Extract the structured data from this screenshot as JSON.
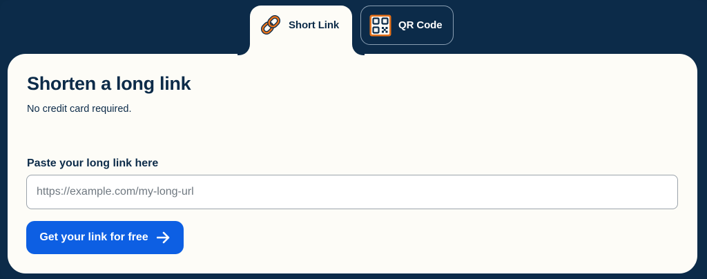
{
  "tabs": {
    "short_link": {
      "label": "Short Link",
      "icon": "link-icon",
      "active": true
    },
    "qr_code": {
      "label": "QR Code",
      "icon": "qr-code-icon",
      "active": false
    }
  },
  "card": {
    "title": "Shorten a long link",
    "subtitle": "No credit card required.",
    "field_label": "Paste your long link here",
    "input": {
      "value": "",
      "placeholder": "https://example.com/my-long-url"
    },
    "cta": {
      "label": "Get your link for free",
      "icon": "arrow-right-icon"
    }
  },
  "colors": {
    "background": "#0c2b49",
    "card": "#fdfcf7",
    "primary": "#0d5fe3",
    "icon_accent": "#e8731c"
  }
}
